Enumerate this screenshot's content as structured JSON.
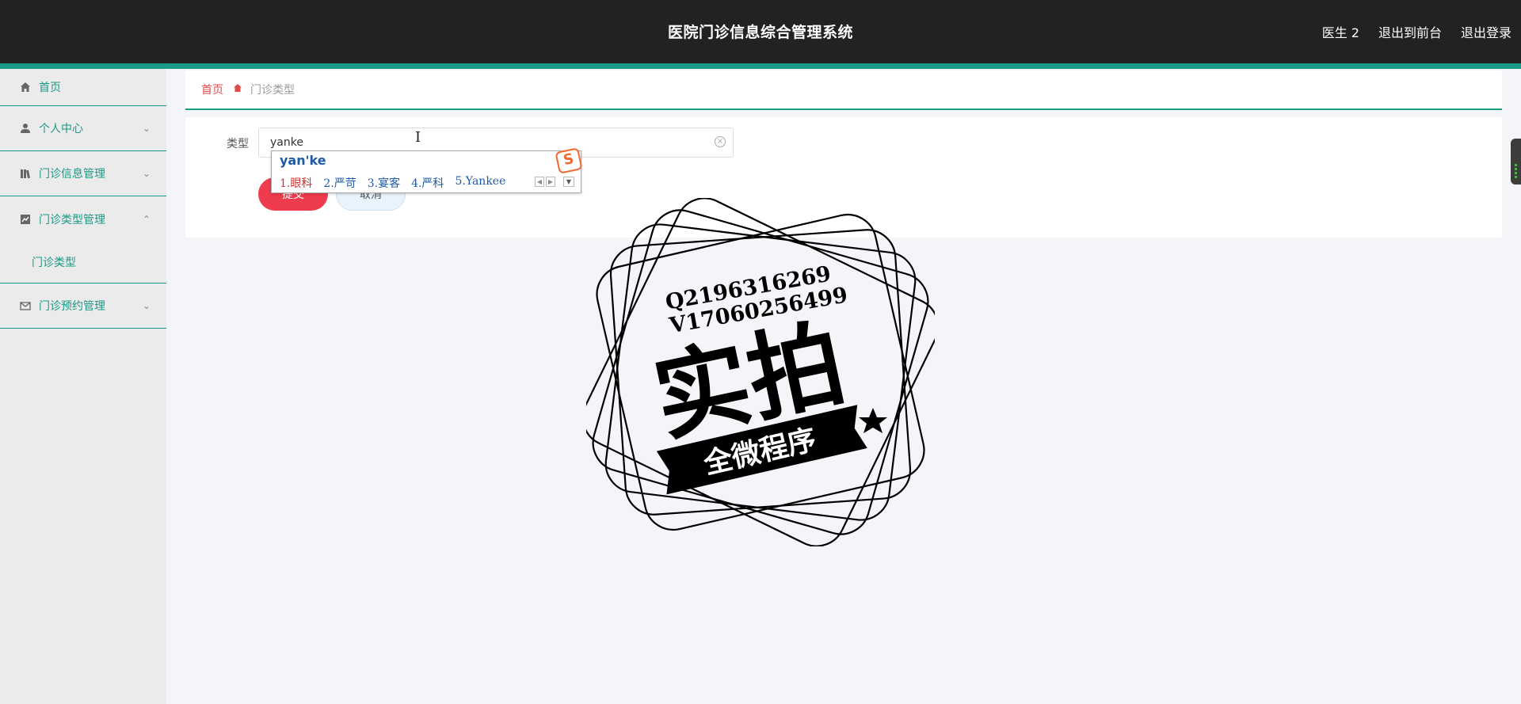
{
  "header": {
    "title": "医院门诊信息综合管理系统",
    "user": "医生 2",
    "front_link": "退出到前台",
    "logout": "退出登录"
  },
  "sidebar": {
    "items": [
      {
        "label": "首页",
        "icon": "home-icon"
      },
      {
        "label": "个人中心",
        "icon": "user-icon"
      },
      {
        "label": "门诊信息管理",
        "icon": "library-icon"
      },
      {
        "label": "门诊类型管理",
        "icon": "chart-icon",
        "sub": [
          "门诊类型"
        ]
      },
      {
        "label": "门诊预约管理",
        "icon": "mail-icon"
      }
    ]
  },
  "breadcrumb": {
    "home": "首页",
    "current": "门诊类型"
  },
  "form": {
    "type_label": "类型",
    "type_value": "yanke",
    "submit_label": "提交",
    "cancel_label": "取消"
  },
  "ime": {
    "composition": "yan'ke",
    "candidates": [
      "1.眼科",
      "2.严苛",
      "3.宴客",
      "4.严科",
      "5.Yankee"
    ],
    "logo": "S"
  },
  "watermark": {
    "line1": "Q2196316269",
    "line2": "V17060256499",
    "main": "实拍",
    "banner": "全微程序"
  },
  "colors": {
    "accent": "#1a9a86",
    "header_bg": "#222222",
    "submit_bg": "#ef3b4e",
    "breadcrumb_home": "#e24a4a"
  }
}
